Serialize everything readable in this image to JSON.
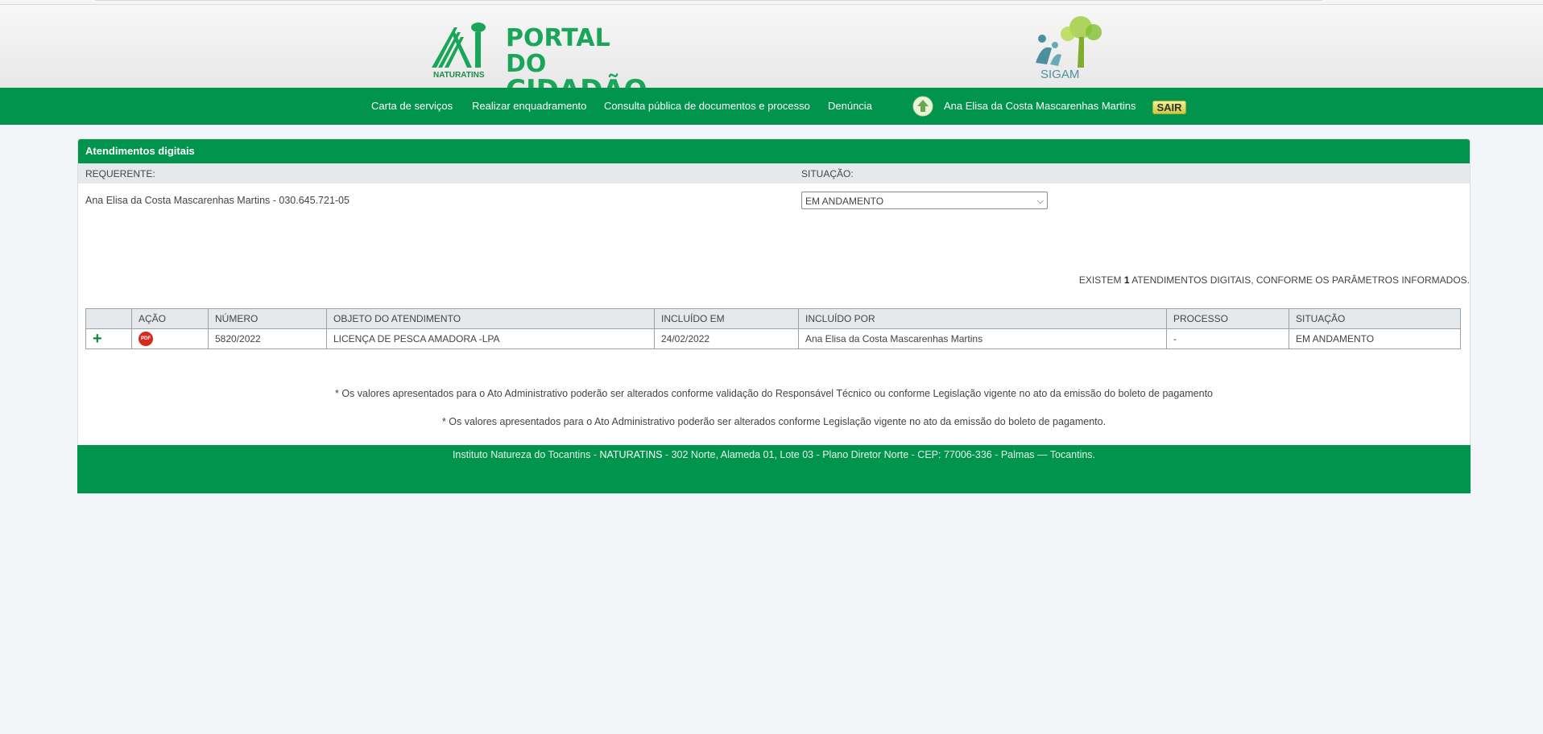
{
  "header": {
    "logo_title_line1": "PORTAL DO",
    "logo_title_line2": "CIDADÃO",
    "logo_org": "NATURATINS",
    "logo_right_text": "SIGAM",
    "brand_color": "#00944c"
  },
  "nav": {
    "items": [
      {
        "label": "Carta de serviços"
      },
      {
        "label": "Realizar enquadramento"
      },
      {
        "label": "Consulta pública de documentos e processo"
      },
      {
        "label": "Denúncia"
      }
    ],
    "user_name": "Ana Elisa da Costa Mascarenhas Martins",
    "logout_label": "SAIR"
  },
  "panel": {
    "title": "Atendimentos digitais",
    "requester_label": "REQUERENTE:",
    "situation_label": "SITUAÇÃO:",
    "requester_value": "Ana Elisa da Costa Mascarenhas Martins - 030.645.721-05",
    "situation_selected": "EM ANDAMENTO",
    "count_prefix": "EXISTEM ",
    "count": "1",
    "count_suffix": " ATENDIMENTOS DIGITAIS, CONFORME OS PARÂMETROS INFORMADOS."
  },
  "table": {
    "columns": [
      "",
      "AÇÃO",
      "NÚMERO",
      "OBJETO DO ATENDIMENTO",
      "INCLUÍDO EM",
      "INCLUÍDO POR",
      "PROCESSO",
      "SITUAÇÃO"
    ],
    "rows": [
      {
        "expand_icon": "plus-icon",
        "action_icon": "pdf-icon",
        "pdf_label": "PDF",
        "numero": "5820/2022",
        "objeto": "LICENÇA DE PESCA AMADORA -LPA",
        "incluido_em": "24/02/2022",
        "incluido_por": "Ana Elisa da Costa Mascarenhas Martins",
        "processo": "-",
        "situacao": "EM ANDAMENTO"
      }
    ]
  },
  "notes": [
    "* Os valores apresentados para o Ato Administrativo poderão ser alterados conforme validação do Responsável Técnico ou conforme Legislação vigente no ato da emissão do boleto de pagamento",
    "* Os valores apresentados para o Ato Administrativo poderão ser alterados conforme Legislação vigente no ato da emissão do boleto de pagamento."
  ],
  "footer": {
    "prefix": "Instituto Natureza do Tocantins - ",
    "org": "NATURATINS",
    "address": " - 302 Norte, Alameda 01, Lote 03 - Plano Diretor Norte - CEP: 77006-336 - Palmas — Tocantins."
  }
}
